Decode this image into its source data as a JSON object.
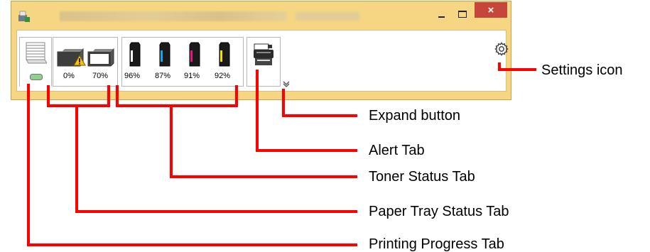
{
  "window": {
    "app_icon": "printer-status-app-icon",
    "close_symbol": "×"
  },
  "tabs": {
    "paper_tray": {
      "trays": [
        {
          "percent": "0%",
          "warning": true
        },
        {
          "percent": "70%",
          "warning": false
        }
      ]
    },
    "toner": {
      "cartridges": [
        {
          "color": "#1a1a1a",
          "percent": "96%"
        },
        {
          "color": "#17a8e0",
          "percent": "87%"
        },
        {
          "color": "#e0197e",
          "percent": "91%"
        },
        {
          "color": "#f2e200",
          "percent": "92%"
        }
      ]
    }
  },
  "callouts": {
    "settings_icon": "Settings icon",
    "expand_button": "Expand button",
    "alert_tab": "Alert Tab",
    "toner_status_tab": "Toner Status Tab",
    "paper_tray_status_tab": "Paper Tray Status Tab",
    "printing_progress_tab": "Printing Progress Tab"
  },
  "colors": {
    "callout_line": "#ff0000",
    "window_frame": "#f6d683",
    "close_button": "#c7463c"
  }
}
